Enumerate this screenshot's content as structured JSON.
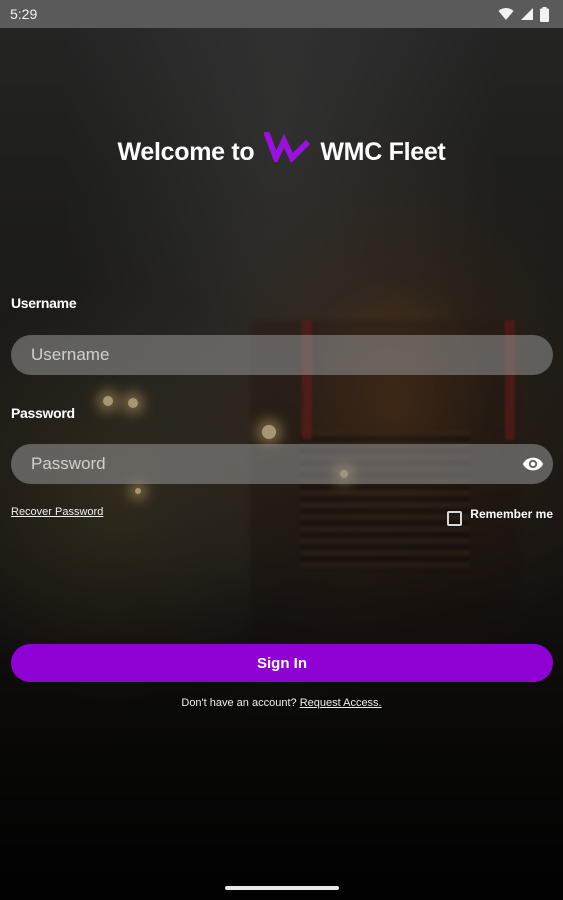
{
  "status_bar": {
    "time": "5:29",
    "icons": [
      "wifi-icon",
      "signal-icon",
      "battery-icon"
    ]
  },
  "header": {
    "welcome_text": "Welcome to",
    "app_name": "WMC Fleet",
    "logo_icon": "wmc-logo-icon"
  },
  "form": {
    "username": {
      "label": "Username",
      "placeholder": "Username",
      "value": ""
    },
    "password": {
      "label": "Password",
      "placeholder": "Password",
      "value": "",
      "toggle_icon": "eye-icon"
    },
    "recover_password": "Recover Password",
    "remember_me": {
      "label": "Remember me",
      "checked": false
    },
    "sign_in_label": "Sign In"
  },
  "footer": {
    "no_account_text": "Don't have an account?",
    "request_access_link": "Request Access."
  },
  "colors": {
    "accent": "#8e02d4",
    "status_bar": "#5a5a5a",
    "input_background": "#7f7f7f"
  }
}
